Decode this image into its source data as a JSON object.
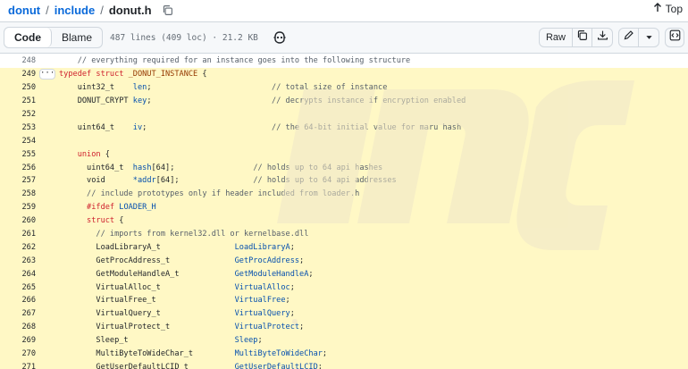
{
  "breadcrumb": {
    "repo": "donut",
    "folder": "include",
    "file": "donut.h",
    "separator": "/"
  },
  "top_link": "Top",
  "file_header": {
    "tabs": [
      {
        "label": "Code",
        "active": true
      },
      {
        "label": "Blame",
        "active": false
      }
    ],
    "meta": "487 lines (409 loc) · 21.2 KB",
    "raw_label": "Raw"
  },
  "icons": {
    "copy_path": "copy-icon",
    "top": "arrow-up-icon",
    "copilot": "copilot-icon",
    "copy_raw": "copy-icon",
    "download": "download-icon",
    "edit": "pencil-icon",
    "more": "triangle-down-icon",
    "symbols": "code-square-icon"
  },
  "code_lines": [
    {
      "n": "248",
      "hl": false,
      "dots": false,
      "segs": [
        {
          "t": "    // everything required for an instance goes into the following structure",
          "c": "cm"
        }
      ]
    },
    {
      "n": "249",
      "hl": true,
      "dots": true,
      "segs": [
        {
          "t": "typedef struct ",
          "c": "kw"
        },
        {
          "t": "_DONUT_INSTANCE",
          "c": "ent"
        },
        {
          "t": " {",
          "c": "tx"
        }
      ]
    },
    {
      "n": "250",
      "hl": true,
      "dots": false,
      "segs": [
        {
          "t": "    uint32_t    ",
          "c": "tx"
        },
        {
          "t": "len",
          "c": "fn"
        },
        {
          "t": ";                          ",
          "c": "tx"
        },
        {
          "t": "// total size of instance",
          "c": "cm"
        }
      ]
    },
    {
      "n": "251",
      "hl": true,
      "dots": false,
      "segs": [
        {
          "t": "    DONUT_CRYPT ",
          "c": "tx"
        },
        {
          "t": "key",
          "c": "fn"
        },
        {
          "t": ";                          ",
          "c": "tx"
        },
        {
          "t": "// decrypts instance if encryption enabled",
          "c": "cm"
        }
      ]
    },
    {
      "n": "252",
      "hl": true,
      "dots": false,
      "segs": [
        {
          "t": "",
          "c": "tx"
        }
      ]
    },
    {
      "n": "253",
      "hl": true,
      "dots": false,
      "segs": [
        {
          "t": "    uint64_t    ",
          "c": "tx"
        },
        {
          "t": "iv",
          "c": "fn"
        },
        {
          "t": ";                           ",
          "c": "tx"
        },
        {
          "t": "// the 64-bit initial value for maru hash",
          "c": "cm"
        }
      ]
    },
    {
      "n": "254",
      "hl": true,
      "dots": false,
      "segs": [
        {
          "t": "",
          "c": "tx"
        }
      ]
    },
    {
      "n": "255",
      "hl": true,
      "dots": false,
      "segs": [
        {
          "t": "    union",
          "c": "kw"
        },
        {
          "t": " {",
          "c": "tx"
        }
      ]
    },
    {
      "n": "256",
      "hl": true,
      "dots": false,
      "segs": [
        {
          "t": "      uint64_t  ",
          "c": "tx"
        },
        {
          "t": "hash",
          "c": "fn"
        },
        {
          "t": "[64];                 ",
          "c": "tx"
        },
        {
          "t": "// holds up to 64 api hashes",
          "c": "cm"
        }
      ]
    },
    {
      "n": "257",
      "hl": true,
      "dots": false,
      "segs": [
        {
          "t": "      void      ",
          "c": "tx"
        },
        {
          "t": "*addr",
          "c": "fn"
        },
        {
          "t": "[64];                ",
          "c": "tx"
        },
        {
          "t": "// holds up to 64 api addresses",
          "c": "cm"
        }
      ]
    },
    {
      "n": "258",
      "hl": true,
      "dots": false,
      "segs": [
        {
          "t": "      // include prototypes only if header included from loader.h",
          "c": "cm"
        }
      ]
    },
    {
      "n": "259",
      "hl": true,
      "dots": false,
      "segs": [
        {
          "t": "      #ifdef ",
          "c": "kw"
        },
        {
          "t": "LOADER_H",
          "c": "fn"
        }
      ]
    },
    {
      "n": "260",
      "hl": true,
      "dots": false,
      "segs": [
        {
          "t": "      struct",
          "c": "kw"
        },
        {
          "t": " {",
          "c": "tx"
        }
      ]
    },
    {
      "n": "261",
      "hl": true,
      "dots": false,
      "segs": [
        {
          "t": "        // imports from kernel32.dll or kernelbase.dll",
          "c": "cm"
        }
      ]
    },
    {
      "n": "262",
      "hl": true,
      "dots": false,
      "segs": [
        {
          "t": "        LoadLibraryA_t                ",
          "c": "tx"
        },
        {
          "t": "LoadLibraryA",
          "c": "fn"
        },
        {
          "t": ";",
          "c": "tx"
        }
      ]
    },
    {
      "n": "263",
      "hl": true,
      "dots": false,
      "segs": [
        {
          "t": "        GetProcAddress_t              ",
          "c": "tx"
        },
        {
          "t": "GetProcAddress",
          "c": "fn"
        },
        {
          "t": ";",
          "c": "tx"
        }
      ]
    },
    {
      "n": "264",
      "hl": true,
      "dots": false,
      "segs": [
        {
          "t": "        GetModuleHandleA_t            ",
          "c": "tx"
        },
        {
          "t": "GetModuleHandleA",
          "c": "fn"
        },
        {
          "t": ";",
          "c": "tx"
        }
      ]
    },
    {
      "n": "265",
      "hl": true,
      "dots": false,
      "segs": [
        {
          "t": "        VirtualAlloc_t                ",
          "c": "tx"
        },
        {
          "t": "VirtualAlloc",
          "c": "fn"
        },
        {
          "t": ";",
          "c": "tx"
        }
      ]
    },
    {
      "n": "266",
      "hl": true,
      "dots": false,
      "segs": [
        {
          "t": "        VirtualFree_t                 ",
          "c": "tx"
        },
        {
          "t": "VirtualFree",
          "c": "fn"
        },
        {
          "t": ";",
          "c": "tx"
        }
      ]
    },
    {
      "n": "267",
      "hl": true,
      "dots": false,
      "segs": [
        {
          "t": "        VirtualQuery_t                ",
          "c": "tx"
        },
        {
          "t": "VirtualQuery",
          "c": "fn"
        },
        {
          "t": ";",
          "c": "tx"
        }
      ]
    },
    {
      "n": "268",
      "hl": true,
      "dots": false,
      "segs": [
        {
          "t": "        VirtualProtect_t              ",
          "c": "tx"
        },
        {
          "t": "VirtualProtect",
          "c": "fn"
        },
        {
          "t": ";",
          "c": "tx"
        }
      ]
    },
    {
      "n": "269",
      "hl": true,
      "dots": false,
      "segs": [
        {
          "t": "        Sleep_t                       ",
          "c": "tx"
        },
        {
          "t": "Sleep",
          "c": "fn"
        },
        {
          "t": ";",
          "c": "tx"
        }
      ]
    },
    {
      "n": "270",
      "hl": true,
      "dots": false,
      "segs": [
        {
          "t": "        MultiByteToWideChar_t         ",
          "c": "tx"
        },
        {
          "t": "MultiByteToWideChar",
          "c": "fn"
        },
        {
          "t": ";",
          "c": "tx"
        }
      ]
    },
    {
      "n": "271",
      "hl": true,
      "dots": false,
      "segs": [
        {
          "t": "        GetUserDefaultLCID_t          ",
          "c": "tx"
        },
        {
          "t": "GetUserDefaultLCID",
          "c": "fn"
        },
        {
          "t": ";",
          "c": "tx"
        }
      ]
    }
  ],
  "colors": {
    "link": "#0969da",
    "highlight": "#fff8c5",
    "keyword": "#cf222e",
    "identifier": "#0550ae",
    "entity": "#953800",
    "comment": "#57606a"
  }
}
